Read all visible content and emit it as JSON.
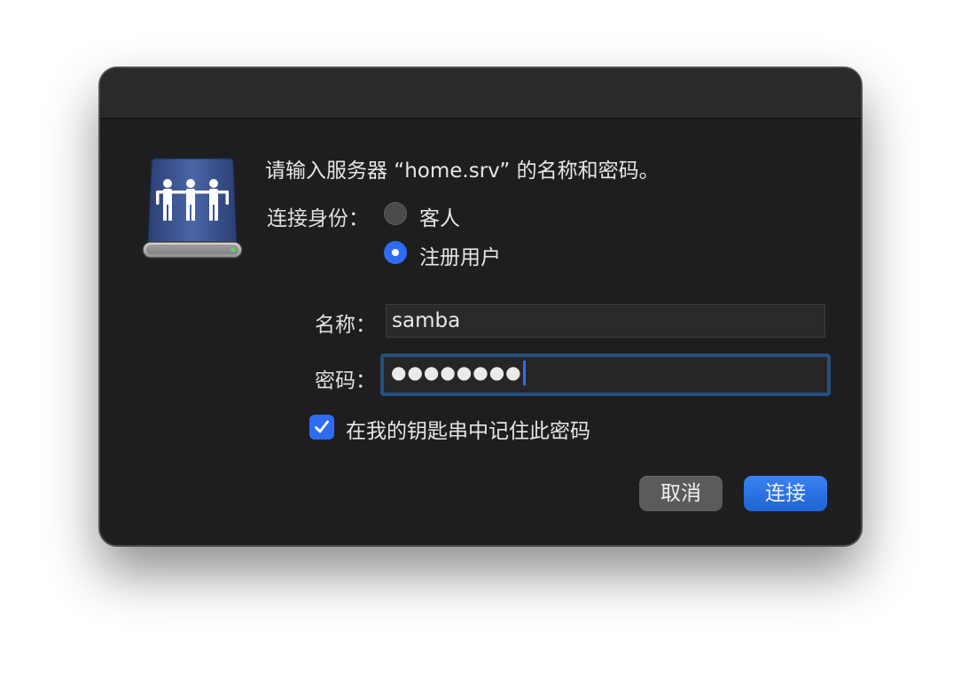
{
  "dialog": {
    "prompt": "请输入服务器 “home.srv” 的名称和密码。",
    "connect_as_label": "连接身份：",
    "radio_options": [
      {
        "label": "客人",
        "selected": false
      },
      {
        "label": "注册用户",
        "selected": true
      }
    ],
    "name_label": "名称：",
    "name_value": "samba",
    "password_label": "密码：",
    "password_masked": "●●●●●●●●",
    "remember_label": "在我的钥匙串中记住此密码",
    "remember_checked": true,
    "cancel_label": "取消",
    "connect_label": "连接"
  },
  "icons": {
    "server": "network-server-icon",
    "check": "checkmark-icon"
  },
  "colors": {
    "accent": "#2e6cf6",
    "dialog_bg": "#1e1e20",
    "titlebar_bg": "#2a2a2c",
    "focus_ring": "#24507f"
  }
}
